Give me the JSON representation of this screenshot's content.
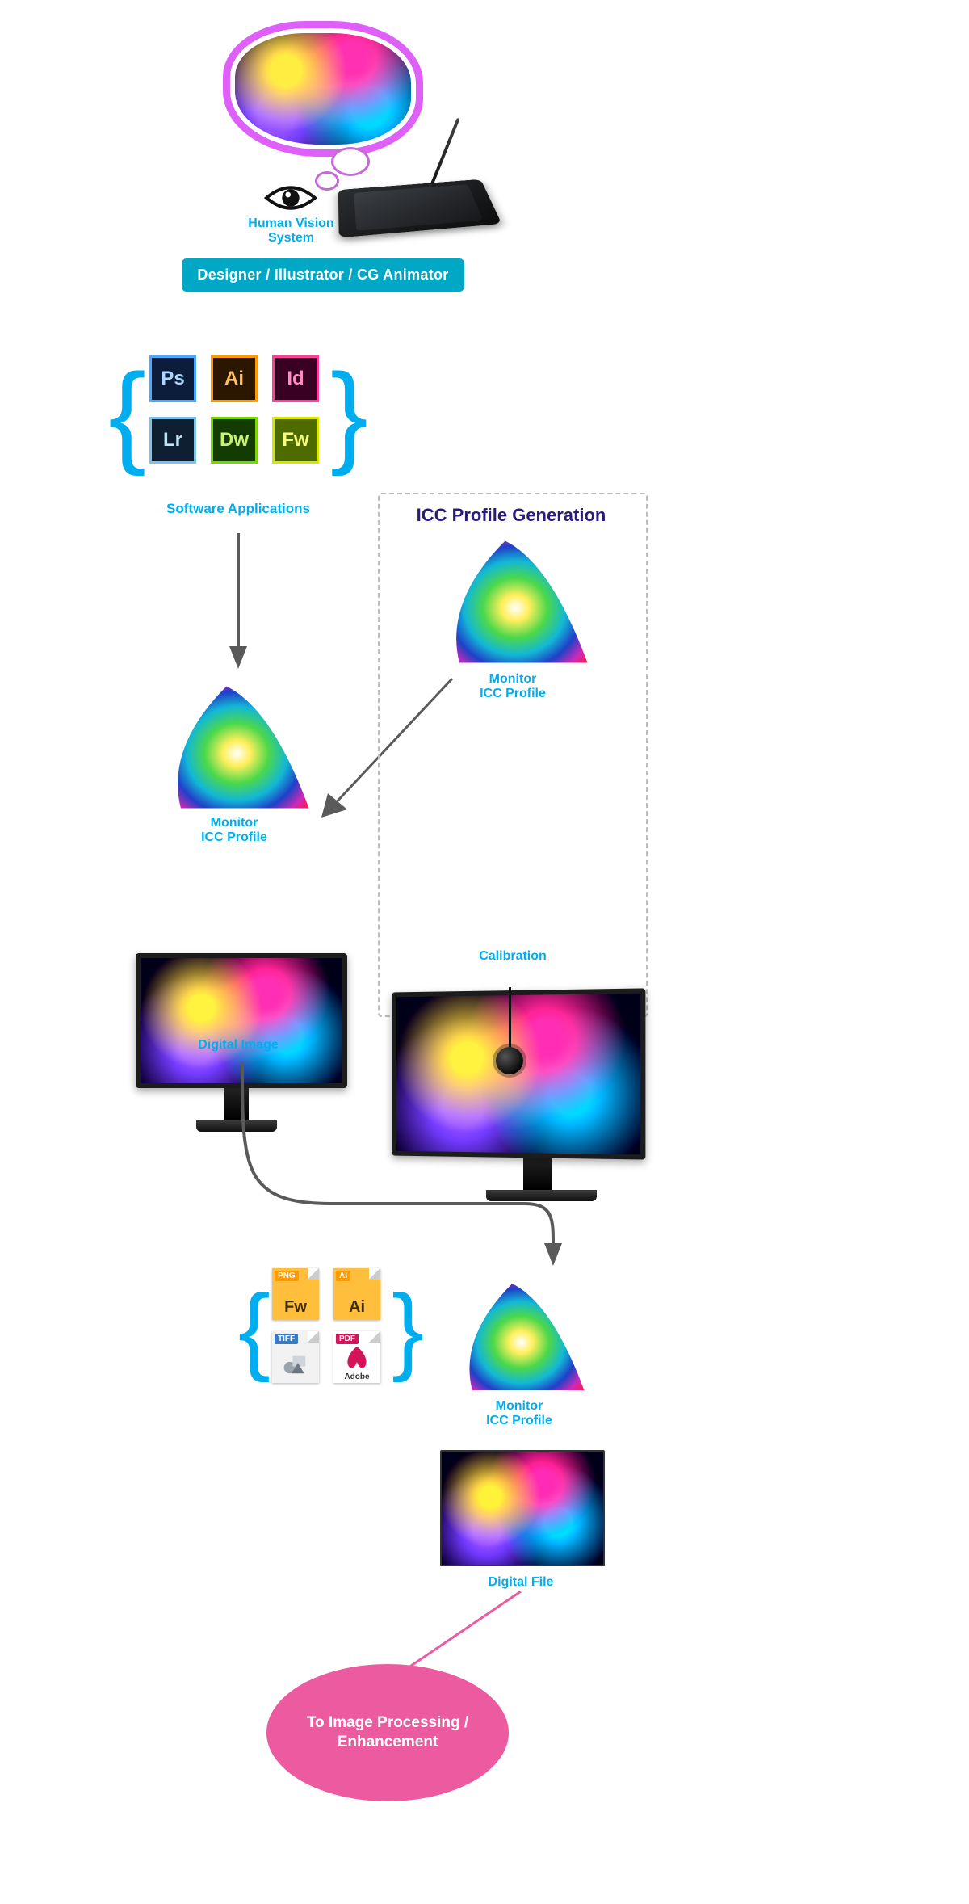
{
  "top": {
    "hvs_label": "Human Vision\nSystem",
    "banner": "Designer / Illustrator / CG Animator"
  },
  "apps": {
    "label": "Software Applications",
    "tiles": [
      "Ps",
      "Ai",
      "Id",
      "Lr",
      "Dw",
      "Fw"
    ]
  },
  "gamut1_label": "Monitor\nICC Profile",
  "digital_image_label": "Digital Image",
  "sidebox": {
    "title": "ICC Profile Generation",
    "gamut_label": "Monitor\nICC Profile",
    "calib_label": "Calibration"
  },
  "filetypes": {
    "items": [
      {
        "tag": "PNG",
        "body": "Fw",
        "tagbg": "#ff9a00",
        "bodycolor": "#3c2a00",
        "bg": "#ffbf3d"
      },
      {
        "tag": "AI",
        "body": "Ai",
        "tagbg": "#ff9a00",
        "bodycolor": "#3c2a00",
        "bg": "#ffbf3d"
      },
      {
        "tag": "TIFF",
        "body": "",
        "tagbg": "#3b7bbd",
        "bodycolor": "#6b6b6b",
        "bg": "#f2f2f2"
      },
      {
        "tag": "PDF",
        "body": "",
        "tagbg": "#d4145a",
        "bodycolor": "#d4145a",
        "bg": "#ffffff",
        "sub": "Adobe"
      }
    ]
  },
  "gamut2_label": "Monitor\nICC Profile",
  "digital_file_label": "Digital File",
  "oval": "To Image Processing /\nEnhancement"
}
